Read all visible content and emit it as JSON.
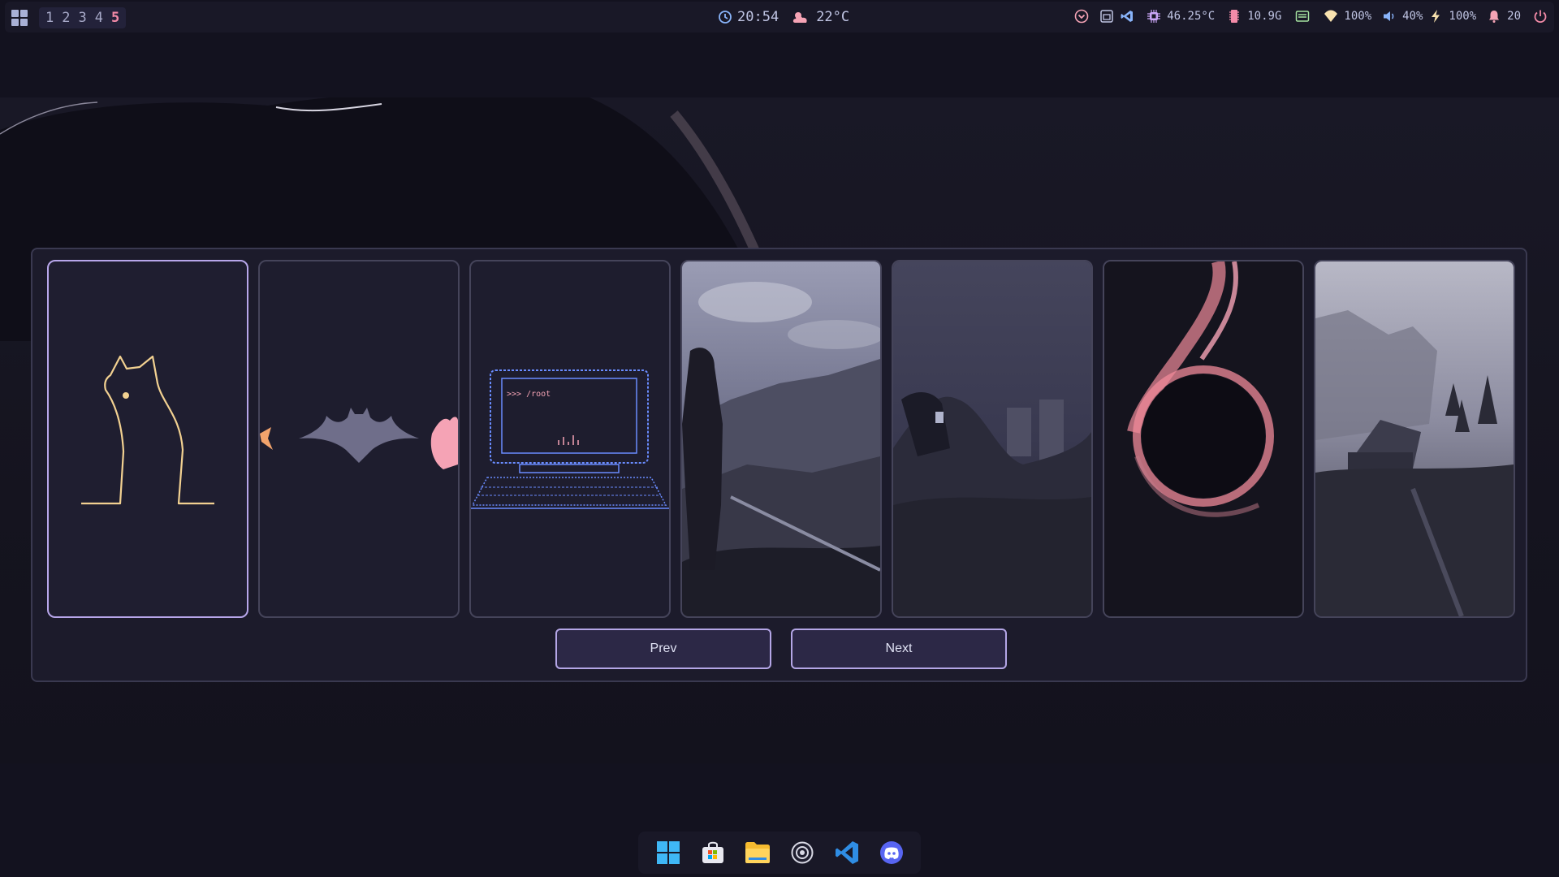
{
  "topbar": {
    "workspaces": [
      "1",
      "2",
      "3",
      "4",
      "5"
    ],
    "active_workspace": "5",
    "clock": "20:54",
    "weather": "22°C",
    "cpu_temp": "46.25°C",
    "memory": "10.9G",
    "wifi": "100%",
    "volume": "40%",
    "battery": "100%",
    "notifications": "20"
  },
  "wallpaper_picker": {
    "cards": [
      {
        "name": "cat-outline",
        "selected": true
      },
      {
        "name": "batman-logo",
        "selected": false
      },
      {
        "name": "retro-computer",
        "selected": false
      },
      {
        "name": "knight-mountains",
        "selected": false
      },
      {
        "name": "batman-dark",
        "selected": false
      },
      {
        "name": "black-hole",
        "selected": false
      },
      {
        "name": "foggy-cabin",
        "selected": false
      }
    ],
    "terminal_text": ">>> /root",
    "prev_label": "Prev",
    "next_label": "Next"
  },
  "dock": {
    "apps": [
      "windows-start",
      "microsoft-store",
      "file-explorer",
      "obs",
      "vscode",
      "discord"
    ]
  },
  "colors": {
    "accent": "#b7a6ea",
    "pink": "#f5a3b5",
    "background": "#13121f",
    "panel": "#1c1b2b"
  }
}
